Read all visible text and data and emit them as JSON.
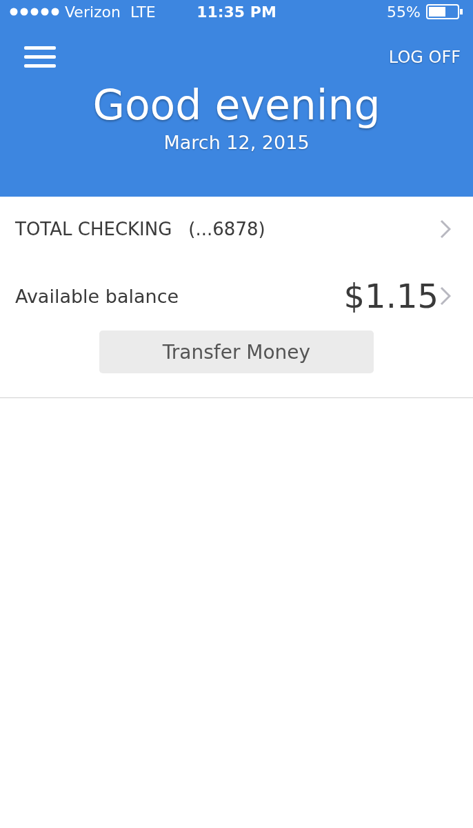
{
  "status_bar": {
    "carrier": "Verizon",
    "network": "LTE",
    "time": "11:35 PM",
    "battery": "55%"
  },
  "header": {
    "action": "LOG OFF",
    "greeting": "Good evening",
    "date": "March 12, 2015"
  },
  "account": {
    "name": "TOTAL CHECKING",
    "number": "(...6878)",
    "balance_label": "Available balance",
    "balance": "$1.15",
    "button": "Transfer Money"
  }
}
